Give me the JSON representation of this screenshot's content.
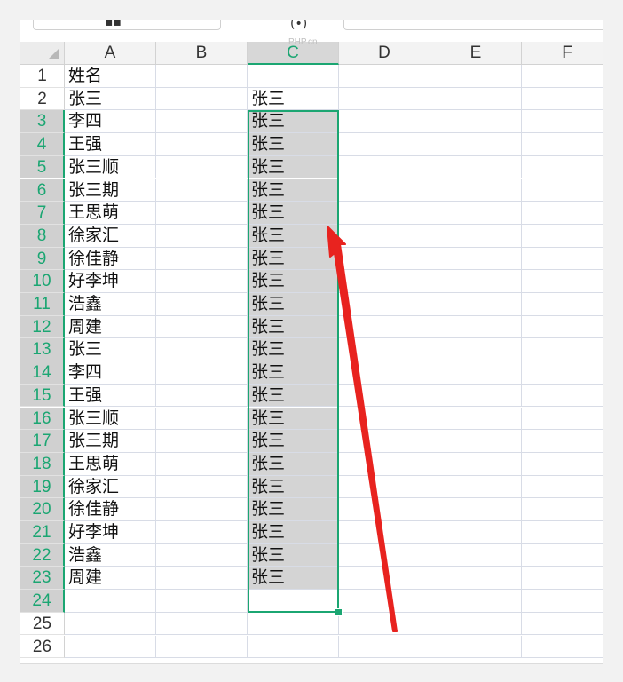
{
  "columns": [
    "A",
    "B",
    "C",
    "D",
    "E",
    "F"
  ],
  "selected_column": "C",
  "rows": [
    {
      "num": "1",
      "a": "姓名",
      "c": ""
    },
    {
      "num": "2",
      "a": "张三",
      "c": "张三"
    },
    {
      "num": "3",
      "a": "李四",
      "c": "张三"
    },
    {
      "num": "4",
      "a": "王强",
      "c": "张三"
    },
    {
      "num": "5",
      "a": "张三顺",
      "c": "张三"
    },
    {
      "num": "6",
      "a": "张三期",
      "c": "张三"
    },
    {
      "num": "7",
      "a": "王思萌",
      "c": "张三"
    },
    {
      "num": "8",
      "a": "徐家汇",
      "c": "张三"
    },
    {
      "num": "9",
      "a": "徐佳静",
      "c": "张三"
    },
    {
      "num": "10",
      "a": "好李坤",
      "c": "张三"
    },
    {
      "num": "11",
      "a": "浩鑫",
      "c": "张三"
    },
    {
      "num": "12",
      "a": "周建",
      "c": "张三"
    },
    {
      "num": "13",
      "a": "张三",
      "c": "张三"
    },
    {
      "num": "14",
      "a": "李四",
      "c": "张三"
    },
    {
      "num": "15",
      "a": "王强",
      "c": "张三"
    },
    {
      "num": "16",
      "a": "张三顺",
      "c": "张三"
    },
    {
      "num": "17",
      "a": "张三期",
      "c": "张三"
    },
    {
      "num": "18",
      "a": "王思萌",
      "c": "张三"
    },
    {
      "num": "19",
      "a": "徐家汇",
      "c": "张三"
    },
    {
      "num": "20",
      "a": "徐佳静",
      "c": "张三"
    },
    {
      "num": "21",
      "a": "好李坤",
      "c": "张三"
    },
    {
      "num": "22",
      "a": "浩鑫",
      "c": "张三"
    },
    {
      "num": "23",
      "a": "周建",
      "c": "张三"
    },
    {
      "num": "24",
      "a": "",
      "c": ""
    },
    {
      "num": "25",
      "a": "",
      "c": ""
    },
    {
      "num": "26",
      "a": "",
      "c": ""
    }
  ],
  "selection": {
    "from_row": 3,
    "to_row": 24
  },
  "watermark": "PHP.cn",
  "colors": {
    "accent": "#1ba672",
    "arrow": "#e8231f",
    "selection_fill": "#d4d4d4"
  }
}
